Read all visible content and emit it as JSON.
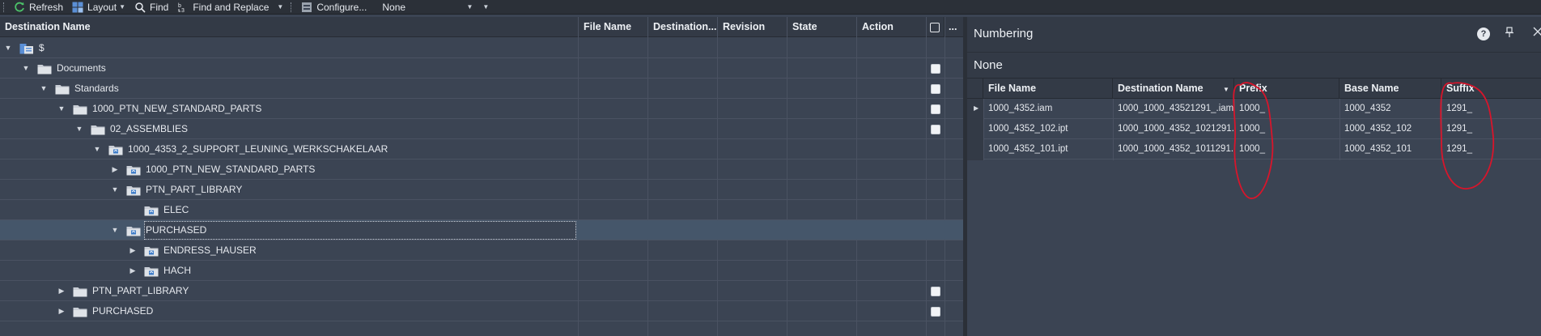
{
  "toolbar": {
    "refresh": "Refresh",
    "layout": "Layout",
    "find": "Find",
    "find_replace": "Find and Replace",
    "configure": "Configure...",
    "scheme_value": "None"
  },
  "left_table": {
    "columns": [
      "Destination Name",
      "File Name",
      "Destination...",
      "Revision",
      "State",
      "Action"
    ],
    "more": "...",
    "rows": [
      {
        "label": "$",
        "icon": "vault-icon"
      },
      {
        "label": "Documents",
        "icon": "folder-icon"
      },
      {
        "label": "Standards",
        "icon": "folder-icon"
      },
      {
        "label": "1000_PTN_NEW_STANDARD_PARTS",
        "icon": "folder-icon"
      },
      {
        "label": "02_ASSEMBLIES",
        "icon": "folder-icon"
      },
      {
        "label": "1000_4353_2_SUPPORT_LEUNING_WERKSCHAKELAAR",
        "icon": "new-folder-icon"
      },
      {
        "label": "1000_PTN_NEW_STANDARD_PARTS",
        "icon": "new-folder-icon"
      },
      {
        "label": "PTN_PART_LIBRARY",
        "icon": "new-folder-icon"
      },
      {
        "label": "ELEC",
        "icon": "new-folder-icon"
      },
      {
        "label": "PURCHASED",
        "icon": "new-folder-icon"
      },
      {
        "label": "ENDRESS_HAUSER",
        "icon": "new-folder-icon"
      },
      {
        "label": "HACH",
        "icon": "new-folder-icon"
      },
      {
        "label": "PTN_PART_LIBRARY",
        "icon": "folder-icon"
      },
      {
        "label": "PURCHASED",
        "icon": "folder-icon"
      }
    ]
  },
  "numbering": {
    "title": "Numbering",
    "help": "?",
    "scheme": "None",
    "columns": [
      "File Name",
      "Destination Name",
      "Prefix",
      "Base Name",
      "Suffix"
    ],
    "rows": [
      {
        "file": "1000_4352.iam",
        "dest": "1000_1000_43521291_.iam",
        "prefix": "1000_",
        "base": "1000_4352",
        "suffix": "1291_"
      },
      {
        "file": "1000_4352_102.ipt",
        "dest": "1000_1000_4352_1021291...",
        "prefix": "1000_",
        "base": "1000_4352_102",
        "suffix": "1291_"
      },
      {
        "file": "1000_4352_101.ipt",
        "dest": "1000_1000_4352_1011291...",
        "prefix": "1000_",
        "base": "1000_4352_101",
        "suffix": "1291_"
      }
    ]
  },
  "colors": {
    "annotation": "#d8152b",
    "selection": "#45566a"
  }
}
